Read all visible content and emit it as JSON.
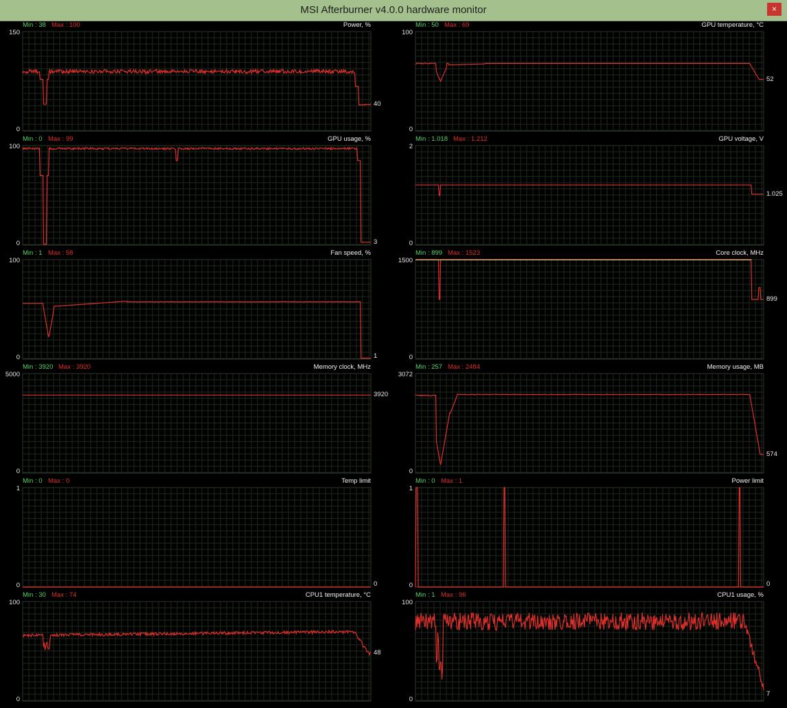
{
  "window": {
    "title": "MSI Afterburner v4.0.0 hardware monitor",
    "close_label": "×"
  },
  "colors": {
    "line": "#e0302b",
    "core_clock_line": "#e8e07a",
    "grid": "#1f2a1f",
    "frame": "#2b3a2b"
  },
  "graphs": [
    {
      "id": "power",
      "name": "Power, %",
      "min_label": "Min : 38",
      "max_label": "Max : 100",
      "axis_max": "150",
      "axis_min": "0",
      "current": "40",
      "scale_max": 150,
      "current_value": 40,
      "shape": "power"
    },
    {
      "id": "gpu-temp",
      "name": "GPU temperature, °C",
      "min_label": "Min : 50",
      "max_label": "Max : 69",
      "axis_max": "100",
      "axis_min": "0",
      "current": "52",
      "scale_max": 100,
      "current_value": 52,
      "shape": "gputemp"
    },
    {
      "id": "gpu-usage",
      "name": "GPU usage, %",
      "min_label": "Min : 0",
      "max_label": "Max : 99",
      "axis_max": "100",
      "axis_min": "0",
      "current": "3",
      "scale_max": 100,
      "current_value": 3,
      "shape": "gpuusage"
    },
    {
      "id": "gpu-voltage",
      "name": "GPU voltage, V",
      "min_label": "Min : 1.018",
      "max_label": "Max : 1.212",
      "axis_max": "2",
      "axis_min": "0",
      "current": "1.025",
      "scale_max": 2,
      "current_value": 1.025,
      "shape": "voltage"
    },
    {
      "id": "fan-speed",
      "name": "Fan speed, %",
      "min_label": "Min : 1",
      "max_label": "Max : 58",
      "axis_max": "100",
      "axis_min": "0",
      "current": "1",
      "scale_max": 100,
      "current_value": 1,
      "shape": "fan"
    },
    {
      "id": "core-clock",
      "name": "Core clock, MHz",
      "min_label": "Min : 899",
      "max_label": "Max : 1523",
      "axis_max": "1500",
      "axis_min": "0",
      "current": "899",
      "scale_max": 1500,
      "current_value": 899,
      "shape": "coreclock"
    },
    {
      "id": "memory-clock",
      "name": "Memory clock, MHz",
      "min_label": "Min : 3920",
      "max_label": "Max : 3920",
      "axis_max": "5000",
      "axis_min": "0",
      "current": "3920",
      "scale_max": 5000,
      "current_value": 3920,
      "shape": "memclock"
    },
    {
      "id": "memory-usage",
      "name": "Memory usage, MB",
      "min_label": "Min : 257",
      "max_label": "Max : 2484",
      "axis_max": "3072",
      "axis_min": "0",
      "current": "574",
      "scale_max": 3072,
      "current_value": 574,
      "shape": "memusage"
    },
    {
      "id": "temp-limit",
      "name": "Temp limit",
      "min_label": "Min : 0",
      "max_label": "Max : 0",
      "axis_max": "1",
      "axis_min": "0",
      "current": "0",
      "scale_max": 1,
      "current_value": 0,
      "shape": "templimit"
    },
    {
      "id": "power-limit",
      "name": "Power limit",
      "min_label": "Min : 0",
      "max_label": "Max : 1",
      "axis_max": "1",
      "axis_min": "0",
      "current": "0",
      "scale_max": 1,
      "current_value": 0,
      "shape": "powerlimit"
    },
    {
      "id": "cpu1-temp",
      "name": "CPU1 temperature, °C",
      "min_label": "Min : 30",
      "max_label": "Max : 74",
      "axis_max": "100",
      "axis_min": "0",
      "current": "48",
      "scale_max": 100,
      "current_value": 48,
      "shape": "cputemp"
    },
    {
      "id": "cpu1-usage",
      "name": "CPU1 usage, %",
      "min_label": "Min : 1",
      "max_label": "Max : 96",
      "axis_max": "100",
      "axis_min": "0",
      "current": "7",
      "scale_max": 100,
      "current_value": 7,
      "shape": "cpuusage"
    }
  ]
}
